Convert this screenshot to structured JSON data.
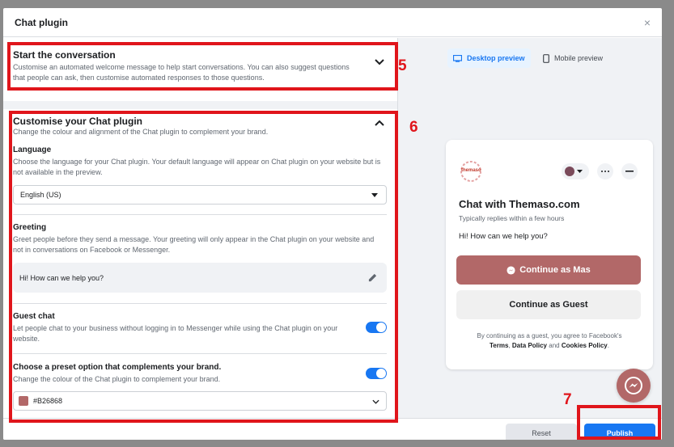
{
  "dialog": {
    "title": "Chat plugin",
    "close_glyph": "×"
  },
  "start_section": {
    "title": "Start the conversation",
    "desc": "Customise an automated welcome message to help start conversations. You can also suggest questions that people can ask, then customise automated responses to those questions."
  },
  "customise_section": {
    "title": "Customise your Chat plugin",
    "desc": "Change the colour and alignment of the Chat plugin to complement your brand.",
    "language": {
      "label": "Language",
      "desc": "Choose the language for your Chat plugin. Your default language will appear on Chat plugin on your website but is not available in the preview.",
      "value": "English (US)"
    },
    "greeting": {
      "label": "Greeting",
      "desc": "Greet people before they send a message. Your greeting will only appear in the Chat plugin on your website and not in conversations on Facebook or Messenger.",
      "value": "Hi! How can we help you?"
    },
    "guest_chat": {
      "label": "Guest chat",
      "desc": "Let people chat to your business without logging in to Messenger while using the Chat plugin on your website.",
      "enabled": true
    },
    "preset": {
      "label": "Choose a preset option that complements your brand.",
      "desc": "Change the colour of the Chat plugin to complement your brand.",
      "enabled": true,
      "color_value": "#B26868"
    }
  },
  "annotations": {
    "n5": "5",
    "n6": "6",
    "n7": "7"
  },
  "preview": {
    "desktop_tab": "Desktop preview",
    "mobile_tab": "Mobile preview",
    "logo_text": "themaso",
    "chat_title": "Chat with Themaso.com",
    "reply_time": "Typically replies within a few hours",
    "greeting": "Hi! How can we help you?",
    "continue_as": "Continue as Mas",
    "continue_guest": "Continue as Guest",
    "disclaimer_pre": "By continuing as a guest, you agree to Facebook's",
    "terms": "Terms",
    "data_policy": "Data Policy",
    "and": "and",
    "cookies_policy": "Cookies Policy"
  },
  "footer": {
    "reset": "Reset",
    "publish": "Publish"
  },
  "colors": {
    "accent": "#1877f2",
    "brand": "#b26868",
    "annotation": "#e0151b"
  }
}
